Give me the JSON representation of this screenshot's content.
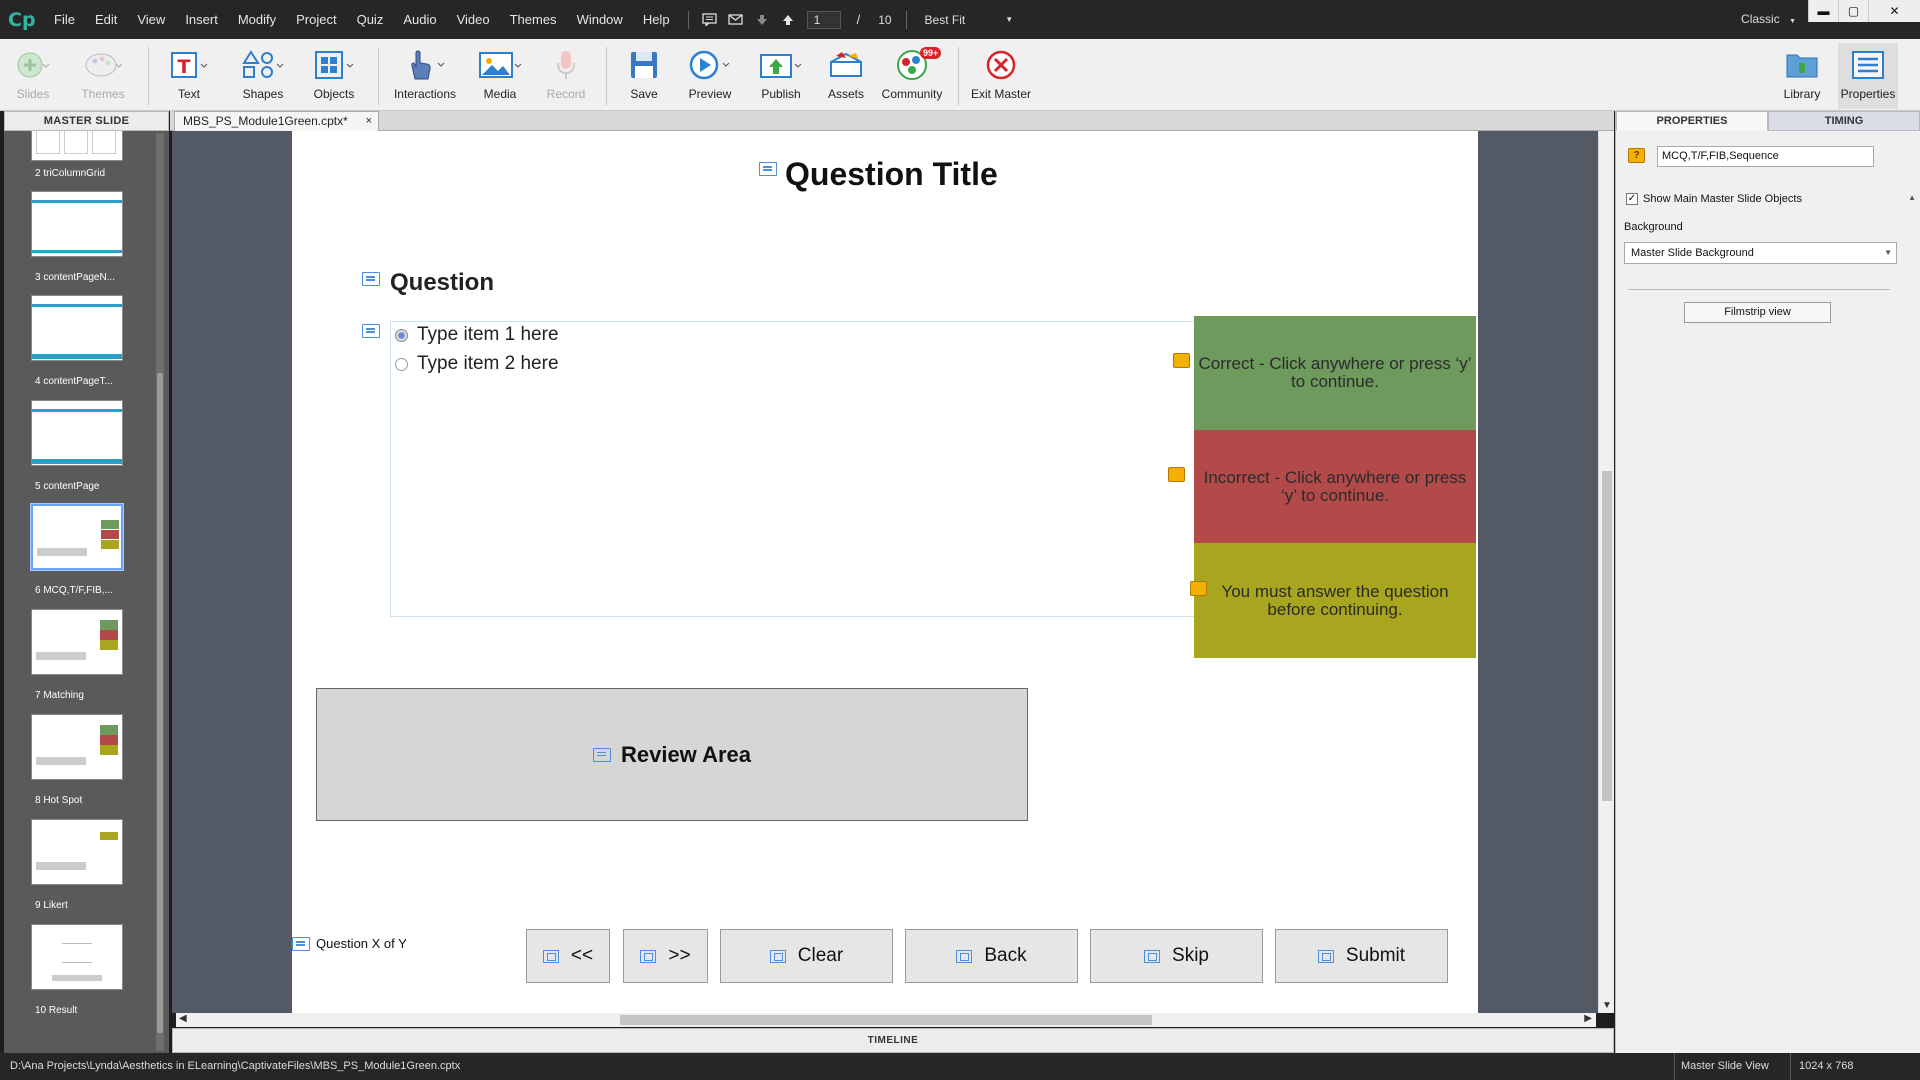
{
  "app": {
    "logo": "Cp",
    "workspace": "Classic"
  },
  "menu": [
    "File",
    "Edit",
    "View",
    "Insert",
    "Modify",
    "Project",
    "Quiz",
    "Audio",
    "Video",
    "Themes",
    "Window",
    "Help"
  ],
  "slide_nav": {
    "current": "1",
    "separator": "/",
    "total": "10",
    "zoom": "Best Fit"
  },
  "toolbar": {
    "slides": "Slides",
    "themes": "Themes",
    "text": "Text",
    "shapes": "Shapes",
    "objects": "Objects",
    "interactions": "Interactions",
    "media": "Media",
    "record": "Record",
    "save": "Save",
    "preview": "Preview",
    "publish": "Publish",
    "assets": "Assets",
    "community": "Community",
    "community_badge": "99+",
    "exit_master": "Exit Master",
    "library": "Library",
    "properties": "Properties"
  },
  "left_panel": {
    "header": "MASTER SLIDE",
    "thumbs": [
      {
        "label": "2 triColumnGrid"
      },
      {
        "label": "3 contentPageN..."
      },
      {
        "label": "4 contentPageT..."
      },
      {
        "label": "5 contentPage"
      },
      {
        "label": "6 MCQ,T/F,FIB,..."
      },
      {
        "label": "7 Matching"
      },
      {
        "label": "8 Hot Spot"
      },
      {
        "label": "9 Likert"
      },
      {
        "label": "10 Result"
      }
    ]
  },
  "document": {
    "tab": "MBS_PS_Module1Green.cptx*",
    "close": "×"
  },
  "slide": {
    "title": "Question Title",
    "question": "Question",
    "answers": [
      "Type item 1 here",
      "Type item 2 here"
    ],
    "feedback": {
      "correct": "Correct - Click anywhere or press ‘y’ to continue.",
      "incorrect": "Incorrect - Click anywhere or press ‘y’ to continue.",
      "incomplete": "You must answer the question before continuing."
    },
    "review": "Review Area",
    "progress": "Question X of Y",
    "buttons": {
      "prev": "<<",
      "next": ">>",
      "clear": "Clear",
      "back": "Back",
      "skip": "Skip",
      "submit": "Submit"
    }
  },
  "timeline": "TIMELINE",
  "right_panel": {
    "tab_properties": "PROPERTIES",
    "tab_timing": "TIMING",
    "name": "MCQ,T/F,FIB,Sequence",
    "show_main": "Show Main Master Slide Objects",
    "bg_label": "Background",
    "bg_value": "Master Slide Background",
    "filmstrip_btn": "Filmstrip view"
  },
  "status": {
    "path": "D:\\Ana Projects\\Lynda\\Aesthetics in ELearning\\CaptivateFiles\\MBS_PS_Module1Green.cptx",
    "view": "Master Slide View",
    "size": "1024 x 768"
  },
  "colors": {
    "correct": "#6f9a5e",
    "incorrect": "#b34a4a",
    "incomplete": "#a8a51f",
    "accent": "#4a8fd8"
  }
}
